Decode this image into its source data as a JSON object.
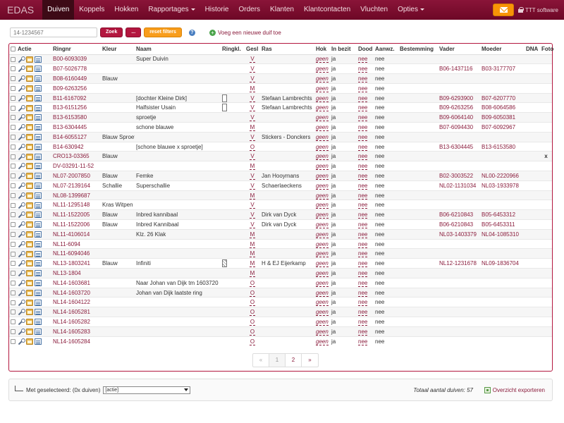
{
  "navbar": {
    "brand": "EDAS",
    "items": [
      {
        "label": "Duiven",
        "active": true,
        "caret": false
      },
      {
        "label": "Koppels",
        "active": false,
        "caret": false
      },
      {
        "label": "Hokken",
        "active": false,
        "caret": false
      },
      {
        "label": "Rapportages",
        "active": false,
        "caret": true
      },
      {
        "label": "Historie",
        "active": false,
        "caret": false
      },
      {
        "label": "Orders",
        "active": false,
        "caret": false
      },
      {
        "label": "Klanten",
        "active": false,
        "caret": false
      },
      {
        "label": "Klantcontacten",
        "active": false,
        "caret": false
      },
      {
        "label": "Vluchten",
        "active": false,
        "caret": false
      },
      {
        "label": "Opties",
        "active": false,
        "caret": true
      }
    ],
    "user": "TTT software",
    "accent": "#7b0b2c"
  },
  "search": {
    "placeholder": "14-1234567",
    "zoek_label": "Zoek",
    "dots_label": "...",
    "reset_label": "reset filters",
    "help": "?",
    "add_link": "Voeg een nieuwe duif toe"
  },
  "table": {
    "headers": [
      "Actie",
      "Ringnr",
      "Kleur",
      "Naam",
      "Ringkl.",
      "Gesl",
      "Ras",
      "Hok",
      "In bezit",
      "Dood",
      "Aanwz.",
      "Bestemming",
      "Vader",
      "Moeder",
      "DNA",
      "Foto"
    ],
    "rows": [
      {
        "ringnr": "B00-6093039",
        "kleur": "",
        "naam": "Super Duivin",
        "ringkl": "",
        "gesl": "V",
        "ras": "",
        "hok": "geen",
        "bezit": "ja",
        "dood": "nee",
        "aanwz": "nee",
        "vader": "",
        "moeder": "",
        "foto": ""
      },
      {
        "ringnr": "B07-5026778",
        "kleur": "",
        "naam": "",
        "ringkl": "",
        "gesl": "V",
        "ras": "",
        "hok": "geen",
        "bezit": "ja",
        "dood": "nee",
        "aanwz": "nee",
        "vader": "B06-1437116",
        "moeder": "B03-3177707",
        "foto": ""
      },
      {
        "ringnr": "B08-6160449",
        "kleur": "Blauw",
        "naam": "",
        "ringkl": "",
        "gesl": "V",
        "ras": "",
        "hok": "geen",
        "bezit": "ja",
        "dood": "nee",
        "aanwz": "nee",
        "vader": "",
        "moeder": "",
        "foto": ""
      },
      {
        "ringnr": "B09-6263256",
        "kleur": "",
        "naam": "",
        "ringkl": "",
        "gesl": "M",
        "ras": "",
        "hok": "geen",
        "bezit": "ja",
        "dood": "nee",
        "aanwz": "nee",
        "vader": "",
        "moeder": "",
        "foto": ""
      },
      {
        "ringnr": "B11-6167092",
        "kleur": "",
        "naam": "[dochter Kleine Dirk]",
        "ringkl": "box",
        "gesl": "V",
        "ras": "Stefaan Lambrechts",
        "hok": "geen",
        "bezit": "ja",
        "dood": "nee",
        "aanwz": "nee",
        "vader": "B09-6293900",
        "moeder": "B07-6207770",
        "foto": ""
      },
      {
        "ringnr": "B13-6151256",
        "kleur": "",
        "naam": "Halfsister Usain",
        "ringkl": "box",
        "gesl": "V",
        "ras": "Stefaan Lambrechts",
        "hok": "geen",
        "bezit": "ja",
        "dood": "nee",
        "aanwz": "nee",
        "vader": "B09-6263256",
        "moeder": "B08-6064586",
        "foto": ""
      },
      {
        "ringnr": "B13-6153580",
        "kleur": "",
        "naam": "sproetje",
        "ringkl": "",
        "gesl": "V",
        "ras": "",
        "hok": "geen",
        "bezit": "ja",
        "dood": "nee",
        "aanwz": "nee",
        "vader": "B09-6064140",
        "moeder": "B09-6050381",
        "foto": ""
      },
      {
        "ringnr": "B13-6304445",
        "kleur": "",
        "naam": "schone blauwe",
        "ringkl": "",
        "gesl": "M",
        "ras": "",
        "hok": "geen",
        "bezit": "ja",
        "dood": "nee",
        "aanwz": "nee",
        "vader": "B07-6094430",
        "moeder": "B07-6092967",
        "foto": ""
      },
      {
        "ringnr": "B14-6055127",
        "kleur": "Blauw Sproet",
        "naam": "",
        "ringkl": "",
        "gesl": "V",
        "ras": "Stickers - Donckers",
        "hok": "geen",
        "bezit": "ja",
        "dood": "nee",
        "aanwz": "nee",
        "vader": "",
        "moeder": "",
        "foto": ""
      },
      {
        "ringnr": "B14-630942",
        "kleur": "",
        "naam": "[schone blauwe x sproetje]",
        "ringkl": "",
        "gesl": "O",
        "ras": "",
        "hok": "geen",
        "bezit": "ja",
        "dood": "nee",
        "aanwz": "nee",
        "vader": "B13-6304445",
        "moeder": "B13-6153580",
        "foto": ""
      },
      {
        "ringnr": "CRO13-03365",
        "kleur": "Blauw",
        "naam": "",
        "ringkl": "",
        "gesl": "V",
        "ras": "",
        "hok": "geen",
        "bezit": "ja",
        "dood": "nee",
        "aanwz": "nee",
        "vader": "",
        "moeder": "",
        "foto": "x"
      },
      {
        "ringnr": "DV-03291-11-52",
        "kleur": "",
        "naam": "",
        "ringkl": "",
        "gesl": "M",
        "ras": "",
        "hok": "geen",
        "bezit": "ja",
        "dood": "nee",
        "aanwz": "nee",
        "vader": "",
        "moeder": "",
        "foto": ""
      },
      {
        "ringnr": "NL07-2007850",
        "kleur": "Blauw",
        "naam": "Femke",
        "ringkl": "",
        "gesl": "V",
        "ras": "Jan Hooymans",
        "hok": "geen",
        "bezit": "ja",
        "dood": "nee",
        "aanwz": "nee",
        "vader": "B02-3003522",
        "moeder": "NL00-2220966",
        "foto": ""
      },
      {
        "ringnr": "NL07-2139164",
        "kleur": "Schallie",
        "naam": "Superschallie",
        "ringkl": "",
        "gesl": "V",
        "ras": "Schaerlaeckens",
        "hok": "geen",
        "bezit": "ja",
        "dood": "nee",
        "aanwz": "nee",
        "vader": "NL02-1131034",
        "moeder": "NL03-1933978",
        "foto": ""
      },
      {
        "ringnr": "NL08-1399687",
        "kleur": "",
        "naam": "",
        "ringkl": "",
        "gesl": "M",
        "ras": "",
        "hok": "geen",
        "bezit": "ja",
        "dood": "nee",
        "aanwz": "nee",
        "vader": "",
        "moeder": "",
        "foto": ""
      },
      {
        "ringnr": "NL11-1295148",
        "kleur": "Kras Witpen",
        "naam": "",
        "ringkl": "",
        "gesl": "V",
        "ras": "",
        "hok": "geen",
        "bezit": "ja",
        "dood": "nee",
        "aanwz": "nee",
        "vader": "",
        "moeder": "",
        "foto": ""
      },
      {
        "ringnr": "NL11-1522005",
        "kleur": "Blauw",
        "naam": "Inbred kannibaal",
        "ringkl": "",
        "gesl": "V",
        "ras": "Dirk van Dyck",
        "hok": "geen",
        "bezit": "ja",
        "dood": "nee",
        "aanwz": "nee",
        "vader": "B06-6210843",
        "moeder": "B05-6453312",
        "foto": ""
      },
      {
        "ringnr": "NL11-1522006",
        "kleur": "Blauw",
        "naam": "Inbred Kannibaal",
        "ringkl": "",
        "gesl": "V",
        "ras": "Dirk van Dyck",
        "hok": "geen",
        "bezit": "ja",
        "dood": "nee",
        "aanwz": "nee",
        "vader": "B06-6210843",
        "moeder": "B05-6453311",
        "foto": ""
      },
      {
        "ringnr": "NL11-4106014",
        "kleur": "",
        "naam": "Klz. 26 Klak",
        "ringkl": "",
        "gesl": "M",
        "ras": "",
        "hok": "geen",
        "bezit": "ja",
        "dood": "nee",
        "aanwz": "nee",
        "vader": "NL03-1403379",
        "moeder": "NL04-1085310",
        "foto": ""
      },
      {
        "ringnr": "NL11-6094",
        "kleur": "",
        "naam": "",
        "ringkl": "",
        "gesl": "M",
        "ras": "",
        "hok": "geen",
        "bezit": "ja",
        "dood": "nee",
        "aanwz": "nee",
        "vader": "",
        "moeder": "",
        "foto": ""
      },
      {
        "ringnr": "NL11-6094046",
        "kleur": "",
        "naam": "",
        "ringkl": "",
        "gesl": "M",
        "ras": "",
        "hok": "geen",
        "bezit": "ja",
        "dood": "nee",
        "aanwz": "nee",
        "vader": "",
        "moeder": "",
        "foto": ""
      },
      {
        "ringnr": "NL13-1803241",
        "kleur": "Blauw",
        "naam": "Infiniti",
        "ringkl": "img",
        "gesl": "M",
        "ras": "H & EJ Eijerkamp",
        "hok": "geen",
        "bezit": "ja",
        "dood": "nee",
        "aanwz": "nee",
        "vader": "NL12-1231678",
        "moeder": "NL09-1836704",
        "foto": ""
      },
      {
        "ringnr": "NL13-1804",
        "kleur": "",
        "naam": "",
        "ringkl": "",
        "gesl": "M",
        "ras": "",
        "hok": "geen",
        "bezit": "ja",
        "dood": "nee",
        "aanwz": "nee",
        "vader": "",
        "moeder": "",
        "foto": ""
      },
      {
        "ringnr": "NL14-1603681",
        "kleur": "",
        "naam": "Naar Johan van Dijk tm 1603720",
        "ringkl": "",
        "gesl": "O",
        "ras": "",
        "hok": "geen",
        "bezit": "ja",
        "dood": "nee",
        "aanwz": "nee",
        "vader": "",
        "moeder": "",
        "foto": ""
      },
      {
        "ringnr": "NL14-1603720",
        "kleur": "",
        "naam": "Johan van Dijk laatste ring",
        "ringkl": "",
        "gesl": "O",
        "ras": "",
        "hok": "geen",
        "bezit": "ja",
        "dood": "nee",
        "aanwz": "nee",
        "vader": "",
        "moeder": "",
        "foto": ""
      },
      {
        "ringnr": "NL14-1604122",
        "kleur": "",
        "naam": "",
        "ringkl": "",
        "gesl": "O",
        "ras": "",
        "hok": "geen",
        "bezit": "ja",
        "dood": "nee",
        "aanwz": "nee",
        "vader": "",
        "moeder": "",
        "foto": ""
      },
      {
        "ringnr": "NL14-1605281",
        "kleur": "",
        "naam": "",
        "ringkl": "",
        "gesl": "O",
        "ras": "",
        "hok": "geen",
        "bezit": "ja",
        "dood": "nee",
        "aanwz": "nee",
        "vader": "",
        "moeder": "",
        "foto": ""
      },
      {
        "ringnr": "NL14-1605282",
        "kleur": "",
        "naam": "",
        "ringkl": "",
        "gesl": "O",
        "ras": "",
        "hok": "geen",
        "bezit": "ja",
        "dood": "nee",
        "aanwz": "nee",
        "vader": "",
        "moeder": "",
        "foto": ""
      },
      {
        "ringnr": "NL14-1605283",
        "kleur": "",
        "naam": "",
        "ringkl": "",
        "gesl": "O",
        "ras": "",
        "hok": "geen",
        "bezit": "ja",
        "dood": "nee",
        "aanwz": "nee",
        "vader": "",
        "moeder": "",
        "foto": ""
      },
      {
        "ringnr": "NL14-1605284",
        "kleur": "",
        "naam": "",
        "ringkl": "",
        "gesl": "O",
        "ras": "",
        "hok": "geen",
        "bezit": "ja",
        "dood": "nee",
        "aanwz": "nee",
        "vader": "",
        "moeder": "",
        "foto": ""
      }
    ]
  },
  "pagination": {
    "items": [
      {
        "label": "«",
        "state": "disabled"
      },
      {
        "label": "1",
        "state": "active"
      },
      {
        "label": "2",
        "state": "normal"
      },
      {
        "label": "»",
        "state": "normal"
      }
    ]
  },
  "footer": {
    "selected_label": "Met geselecteerd: (0x duiven)",
    "action_value": "[actie]",
    "total": "Totaal aantal duiven: 57",
    "export_label": "Overzicht exporteren"
  }
}
